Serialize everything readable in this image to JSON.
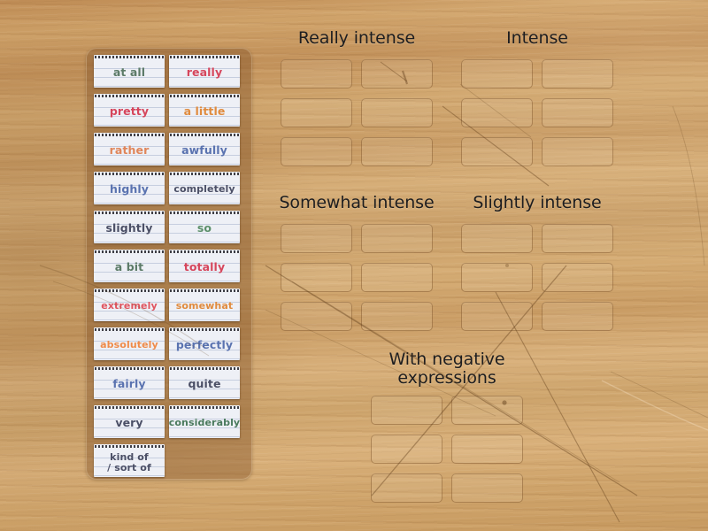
{
  "board": {
    "background_color": "#c99b62",
    "surface": "wood-texture"
  },
  "tray": {
    "name": "word-card-tray",
    "cards": [
      {
        "text": "at all",
        "color": "#5c7b68"
      },
      {
        "text": "really",
        "color": "#d6465c"
      },
      {
        "text": "pretty",
        "color": "#d6465c"
      },
      {
        "text": "a little",
        "color": "#e08b3e"
      },
      {
        "text": "rather",
        "color": "#e0865a"
      },
      {
        "text": "awfully",
        "color": "#5a73b0"
      },
      {
        "text": "highly",
        "color": "#5a73b0"
      },
      {
        "text": "completely",
        "color": "#4b4f66"
      },
      {
        "text": "slightly",
        "color": "#4b4f66"
      },
      {
        "text": "so",
        "color": "#5c8f6a"
      },
      {
        "text": "a bit",
        "color": "#5c7b68"
      },
      {
        "text": "totally",
        "color": "#d6465c"
      },
      {
        "text": "extremely",
        "color": "#e0555f"
      },
      {
        "text": "somewhat",
        "color": "#e08b3e"
      },
      {
        "text": "absolutely",
        "color": "#ef8b4a"
      },
      {
        "text": "perfectly",
        "color": "#5a73b0"
      },
      {
        "text": "fairly",
        "color": "#5a73b0"
      },
      {
        "text": "quite",
        "color": "#4b4f66"
      },
      {
        "text": "very",
        "color": "#4b4f66"
      },
      {
        "text": "considerably",
        "color": "#4a7a5d"
      },
      {
        "text": "kind of\n/ sort of",
        "color": "#4b4f66"
      }
    ]
  },
  "groups": [
    {
      "name": "really-intense",
      "title": "Really intense",
      "slot_count": 6
    },
    {
      "name": "intense",
      "title": "Intense",
      "slot_count": 6
    },
    {
      "name": "somewhat-intense",
      "title": "Somewhat intense",
      "slot_count": 6
    },
    {
      "name": "slightly-intense",
      "title": "Slightly intense",
      "slot_count": 6
    },
    {
      "name": "with-negative-expressions",
      "title": "With negative\nexpressions",
      "slot_count": 6
    }
  ]
}
